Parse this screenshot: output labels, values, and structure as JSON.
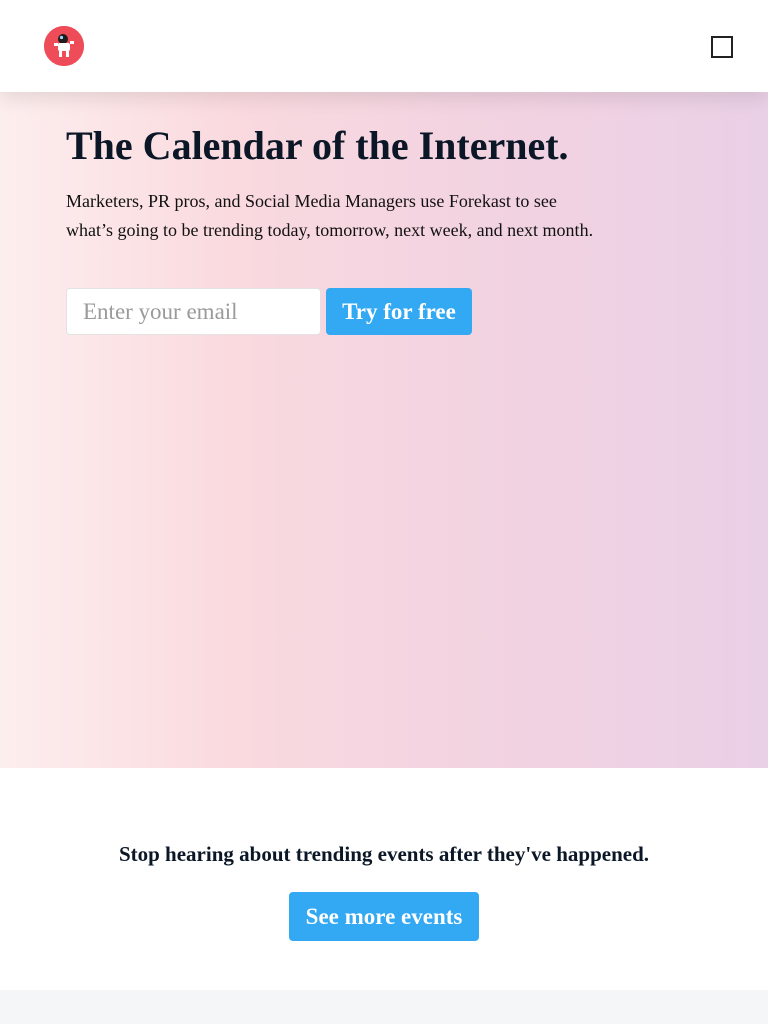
{
  "header": {
    "logo_icon": "astronaut-rocket-icon",
    "logo_color": "#ee4c58",
    "menu_icon": "square-menu-icon"
  },
  "hero": {
    "title": "The Calendar of the Internet.",
    "description": "Marketers, PR pros, and Social Media Managers use Forekast to see what’s going to be trending today, tomorrow, next week, and next month.",
    "email_placeholder": "Enter your email",
    "email_value": "",
    "cta_label": "Try for free"
  },
  "cta_section": {
    "text": "Stop hearing about trending events after they've happened.",
    "button_label": "See more events"
  },
  "colors": {
    "accent": "#33a8f3",
    "heading": "#0b1726"
  }
}
